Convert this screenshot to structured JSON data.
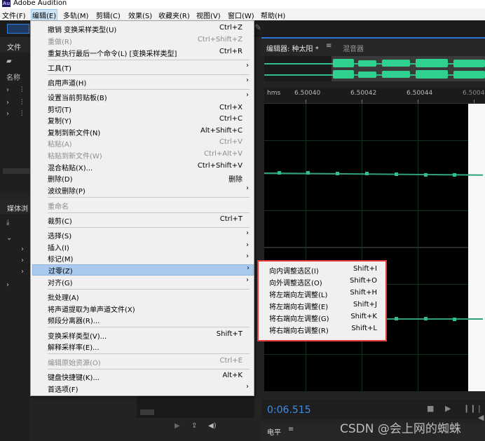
{
  "app": {
    "title": "Adobe Audition",
    "logo": "Au"
  },
  "menubar": {
    "items": [
      "文件(F)",
      "编辑(E)",
      "多轨(M)",
      "剪辑(C)",
      "效果(S)",
      "收藏夹(R)",
      "视图(V)",
      "窗口(W)",
      "帮助(H)"
    ],
    "active": "编辑(E)"
  },
  "left_panel": {
    "files_tab": "文件",
    "name_col": "名称",
    "media_tab": "媒体浏"
  },
  "editor": {
    "tab_editor": "编辑器: 种太阳 *",
    "tab_mixer": "混音器",
    "ruler": [
      "hms",
      "6.50040",
      "6.50042",
      "6.50044",
      "6.50046"
    ],
    "timecode": "0:06.515",
    "level_label": "电平"
  },
  "edit_menu": {
    "undo": {
      "label": "撤销 变换采样类型(U)",
      "key": "Ctrl+Z"
    },
    "redo": {
      "label": "重做(R)",
      "key": "Ctrl+Shift+Z"
    },
    "repeat_last": {
      "label": "重复执行最后一个命令(L) [变换采样类型]",
      "key": "Ctrl+R"
    },
    "tools": {
      "label": "工具(T)"
    },
    "enable_channels": {
      "label": "启用声道(H)"
    },
    "set_clipboard": {
      "label": "设置当前剪贴板(B)"
    },
    "cut": {
      "label": "剪切(T)",
      "key": "Ctrl+X"
    },
    "copy": {
      "label": "复制(Y)",
      "key": "Ctrl+C"
    },
    "copy_new": {
      "label": "复制到新文件(N)",
      "key": "Alt+Shift+C"
    },
    "paste": {
      "label": "粘贴(A)",
      "key": "Ctrl+V"
    },
    "paste_new": {
      "label": "粘贴到新文件(W)",
      "key": "Ctrl+Alt+V"
    },
    "mix_paste": {
      "label": "混合粘贴(X)...",
      "key": "Ctrl+Shift+V"
    },
    "delete": {
      "label": "删除(D)",
      "key": "删除"
    },
    "ripple_delete": {
      "label": "波纹删除(P)"
    },
    "rename": {
      "label": "重命名"
    },
    "crop": {
      "label": "裁剪(C)",
      "key": "Ctrl+T"
    },
    "select": {
      "label": "选择(S)"
    },
    "insert": {
      "label": "插入(I)"
    },
    "marker": {
      "label": "标记(M)"
    },
    "zero_crossings": {
      "label": "过零(Z)"
    },
    "snapping": {
      "label": "对齐(G)"
    },
    "batch": {
      "label": "批处理(A)"
    },
    "extract_channels": {
      "label": "将声道提取为单声道文件(X)"
    },
    "freq_split": {
      "label": "频段分离器(R)..."
    },
    "convert_sample": {
      "label": "变换采样类型(V)...",
      "key": "Shift+T"
    },
    "interpret_rate": {
      "label": "解释采样率(E)..."
    },
    "edit_original": {
      "label": "编辑原始资源(O)",
      "key": "Ctrl+E"
    },
    "shortcuts": {
      "label": "键盘快捷键(K)...",
      "key": "Alt+K"
    },
    "preferences": {
      "label": "首选项(F)"
    }
  },
  "zero_crossings_submenu": [
    {
      "label": "向内调整选区(I)",
      "key": "Shift+I"
    },
    {
      "label": "向外调整选区(O)",
      "key": "Shift+O"
    },
    {
      "label": "将左端向左调整(L)",
      "key": "Shift+H"
    },
    {
      "label": "将左端向右调整(E)",
      "key": "Shift+J"
    },
    {
      "label": "将右端向左调整(G)",
      "key": "Shift+K"
    },
    {
      "label": "将右端向右调整(R)",
      "key": "Shift+L"
    }
  ],
  "watermark": "CSDN @会上网的蜘蛛",
  "colors": {
    "accent": "#2f73d8",
    "waveform": "#2fd18f",
    "highlight_box": "#e53b3b",
    "menu_hover": "#a9c9ef",
    "timecode": "#3d8fe8"
  }
}
